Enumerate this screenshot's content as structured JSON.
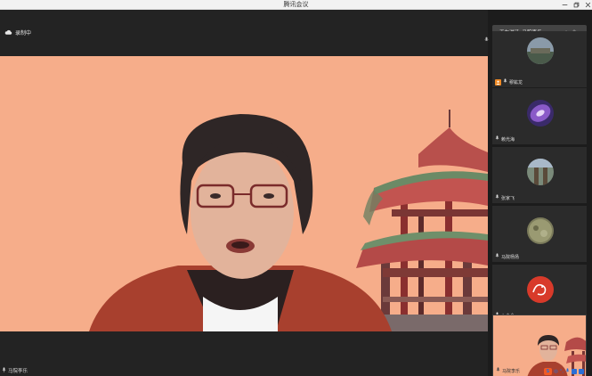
{
  "window": {
    "title": "腾讯会议"
  },
  "main": {
    "recording_label": "录制中",
    "speaker_name": "马院李乐"
  },
  "side": {
    "speaking_text": "正在讲话: 马院李乐",
    "participants": [
      {
        "name": "穆鉱龙"
      },
      {
        "name": "赖光海"
      },
      {
        "name": "张家飞"
      },
      {
        "name": "马院杨扬"
      },
      {
        "name": "卜令全"
      }
    ],
    "self_name": "马院李乐"
  },
  "tray": {
    "ime_label": "S",
    "ime_lang": "中",
    "punct": "°,"
  },
  "colors": {
    "background": "#f6ad8a",
    "panel": "#1c1c1c",
    "accent": "#2a6ed6"
  }
}
